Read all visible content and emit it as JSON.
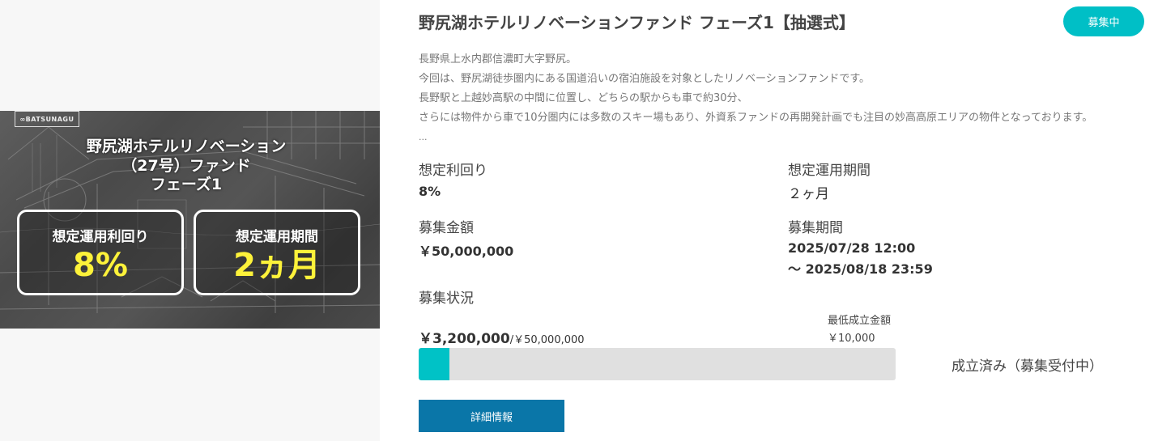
{
  "banner": {
    "logo": "∞BATSUNAGU",
    "title_lines": [
      "野尻湖ホテルリノベーション",
      "（27号）ファンド",
      "フェーズ1"
    ],
    "box_yield_label": "想定運用利回り",
    "box_yield_value": "8%",
    "box_period_label": "想定運用期間",
    "box_period_value": "2ヵ月",
    "accent_color": "#fdf23a"
  },
  "fund": {
    "title": "野尻湖ホテルリノベーションファンド フェーズ1【抽選式】",
    "status_badge": "募集中",
    "description": [
      "長野県上水内郡信濃町大字野尻。",
      "今回は、野尻湖徒歩圏内にある国道沿いの宿泊施設を対象としたリノベーションファンドです。",
      "長野駅と上越妙高駅の中間に位置し、どちらの駅からも車で約30分、",
      "さらには物件から車で10分圏内には多数のスキー場もあり、外資系ファンドの再開発計画でも注目の妙高高原エリアの物件となっております。",
      "..."
    ],
    "yield_label": "想定利回り",
    "yield_value": "8%",
    "period_label": "想定運用期間",
    "period_value": "２ヶ月",
    "amount_label": "募集金額",
    "amount_value": "￥50,000,000",
    "recruit_period_label": "募集期間",
    "recruit_start": "2025/07/28 12:00",
    "recruit_end": "～ 2025/08/18 23:59",
    "progress_label": "募集状況",
    "current_amount": "￥3,200,000",
    "total_amount": "/￥50,000,000",
    "min_label": "最低成立金額",
    "min_value": "￥10,000",
    "progress_ratio": 0.064,
    "status_text": "成立済み（募集受付中）",
    "detail_button": "詳細情報"
  },
  "colors": {
    "badge": "#00bfc6",
    "progress_fill": "#00c2c6",
    "progress_track": "#e0e0e0",
    "button": "#0a76a8"
  }
}
